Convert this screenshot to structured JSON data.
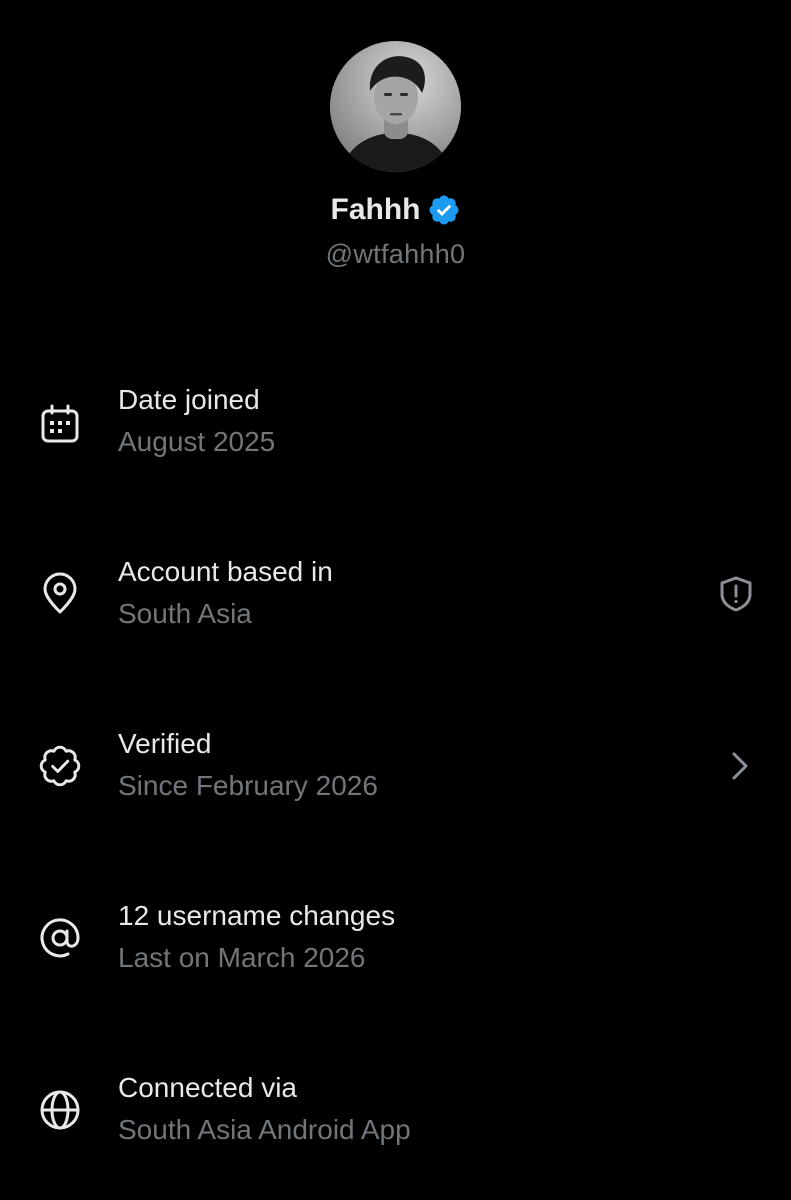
{
  "profile": {
    "display_name": "Fahhh",
    "handle": "@wtfahhh0",
    "verified": true
  },
  "colors": {
    "background": "#000000",
    "primary_text": "#e7e9ea",
    "secondary_text": "#71767b",
    "verified_blue": "#1d9bf0"
  },
  "rows": [
    {
      "icon": "calendar-icon",
      "title": "Date joined",
      "subtitle": "August 2025"
    },
    {
      "icon": "location-pin-icon",
      "title": "Account based in",
      "subtitle": "South Asia",
      "trailing_icon": "shield-alert-icon"
    },
    {
      "icon": "verified-check-icon",
      "title": "Verified",
      "subtitle": "Since February 2026",
      "trailing_icon": "chevron-right-icon"
    },
    {
      "icon": "at-sign-icon",
      "title": "12 username changes",
      "subtitle": "Last on March 2026"
    },
    {
      "icon": "globe-icon",
      "title": "Connected via",
      "subtitle": "South Asia Android App"
    }
  ]
}
